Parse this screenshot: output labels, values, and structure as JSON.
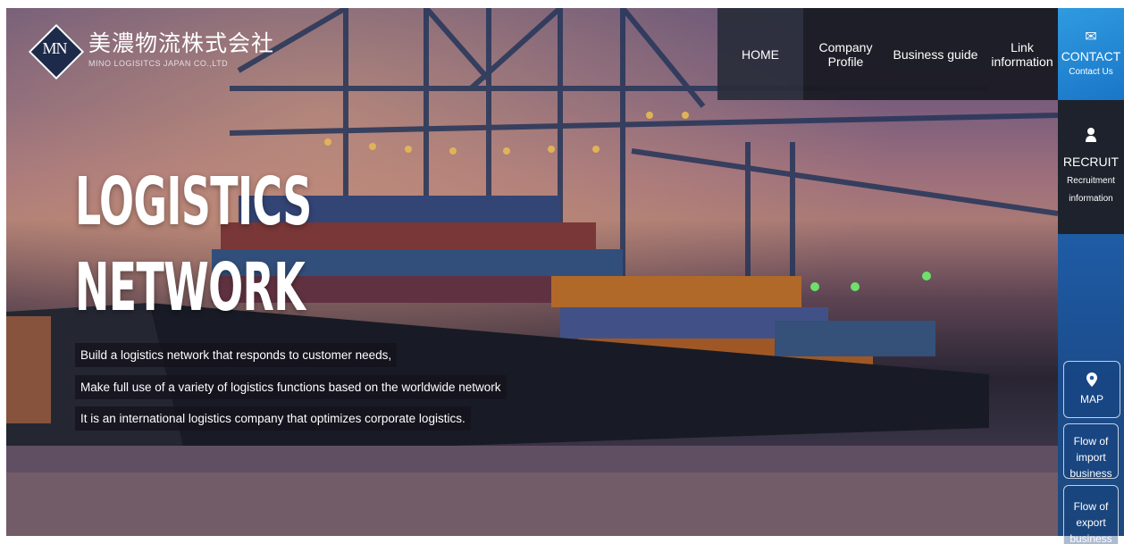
{
  "logo": {
    "mark": "MN",
    "name_jp": "美濃物流株式会社",
    "name_en": "MINO LOGISITCS JAPAN CO.,LTD"
  },
  "nav": {
    "home": "HOME",
    "company_profile": "Company Profile",
    "business_guide": "Business guide",
    "link_information": "Link information"
  },
  "contact": {
    "icon": "mail-icon",
    "title": "CONTACT",
    "subtitle": "Contact Us"
  },
  "recruit": {
    "icon": "person-icon",
    "title": "RECRUIT",
    "subtitle": "Recruitment information"
  },
  "side_buttons": {
    "map": "MAP",
    "import_flow": "Flow of import business",
    "export_flow": "Flow of export business"
  },
  "hero": {
    "headline_line1": "LOGISTICS",
    "headline_line2": "NETWORK",
    "tagline1": "Build a logistics network that responds to customer needs,",
    "tagline2": "Make full use of a variety of logistics functions based on the worldwide network",
    "tagline3": "It is an international logistics company that optimizes corporate logistics."
  },
  "colors": {
    "contact_blue": "#1a76c8",
    "recruit_dark": "#1d222c",
    "nav_dark": "#191b23"
  }
}
